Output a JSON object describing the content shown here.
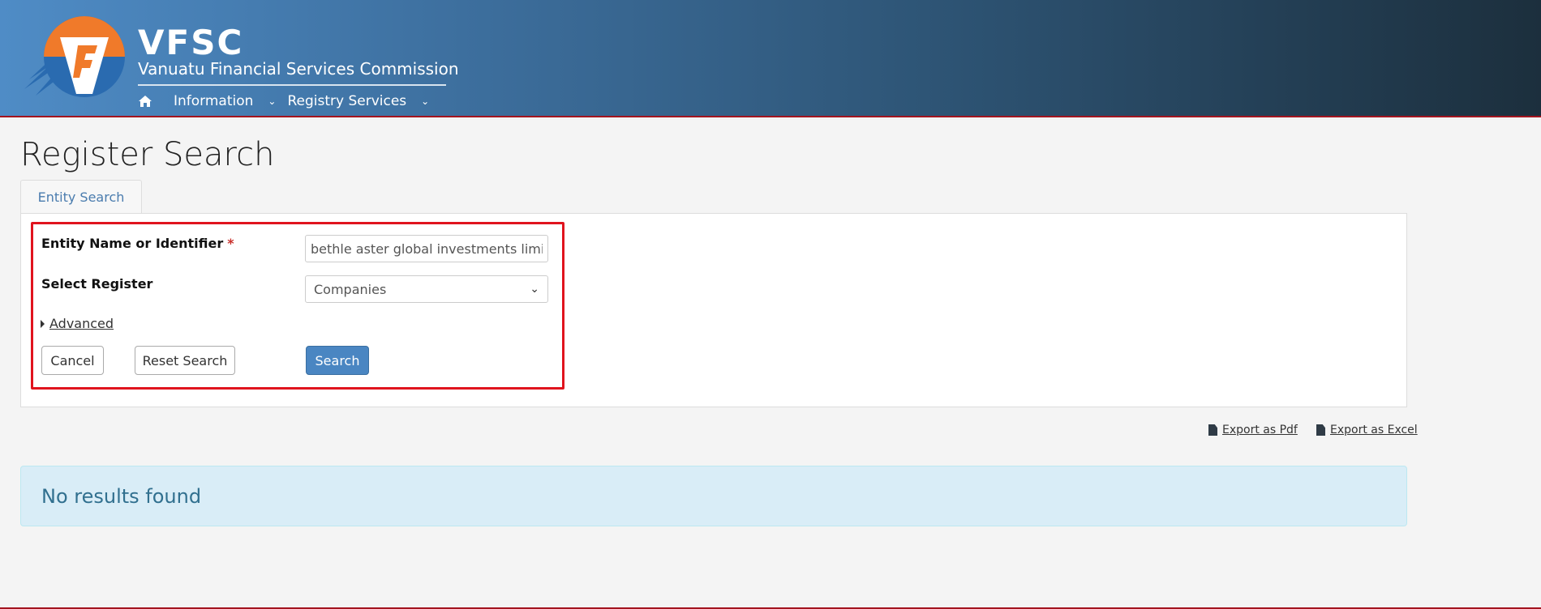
{
  "header": {
    "brand_title": "VFSC",
    "brand_subtitle": "Vanuatu Financial Services Commission",
    "logo_letter": "F",
    "nav": [
      {
        "icon": "home-icon"
      },
      {
        "label": "Information"
      },
      {
        "label": "Registry Services"
      }
    ]
  },
  "page": {
    "title": "Register Search",
    "tab_label": "Entity Search"
  },
  "form": {
    "entity_label": "Entity Name or Identifier",
    "required_mark": "*",
    "entity_value": "bethle aster global investments limited",
    "register_label": "Select Register",
    "register_value": "Companies",
    "advanced_label": "Advanced",
    "cancel_label": "Cancel",
    "reset_label": "Reset Search",
    "search_label": "Search"
  },
  "exports": {
    "pdf_label": "Export as Pdf",
    "excel_label": "Export as Excel"
  },
  "results": {
    "message": "No results found"
  },
  "colors": {
    "highlight": "#e0141e",
    "primary_button": "#4a86c2",
    "alert_bg": "#d9edf7",
    "alert_text": "#31708f"
  }
}
